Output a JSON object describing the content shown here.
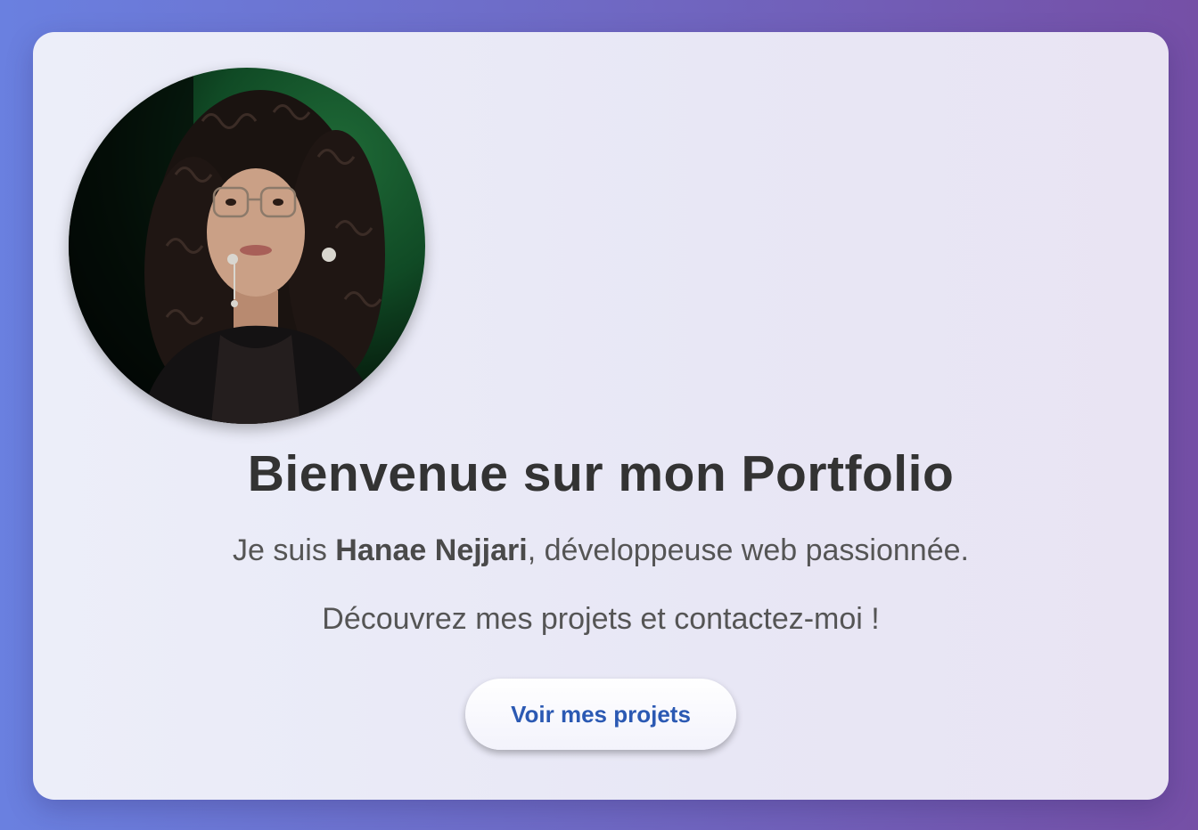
{
  "hero": {
    "title": "Bienvenue sur mon Portfolio",
    "intro_prefix": "Je suis ",
    "name": "Hanae Nejjari",
    "intro_suffix": ", développeuse web passionnée.",
    "cta_text": "Découvrez mes projets et contactez-moi !",
    "button_label": "Voir mes projets"
  },
  "colors": {
    "page_gradient_start": "#6a80e0",
    "page_gradient_end": "#754fa6",
    "card_background": "#eceef9",
    "title": "#333333",
    "body_text": "#555555",
    "button_text": "#2b59b3"
  },
  "icons": {
    "avatar": "profile-photo"
  }
}
